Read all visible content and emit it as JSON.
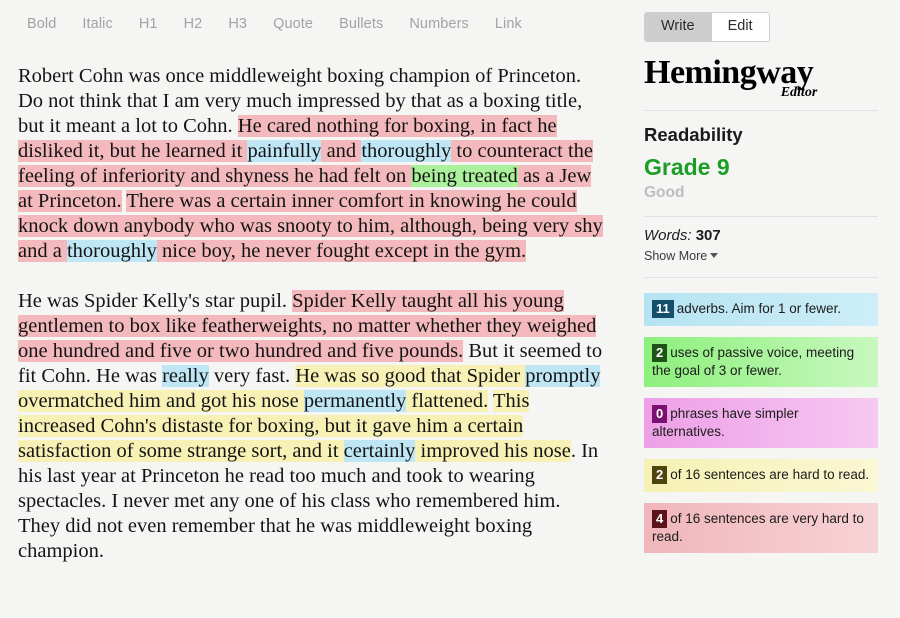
{
  "toolbar": {
    "items": [
      {
        "label": "Bold",
        "name": "bold"
      },
      {
        "label": "Italic",
        "name": "italic"
      },
      {
        "label": "H1",
        "name": "h1"
      },
      {
        "label": "H2",
        "name": "h2"
      },
      {
        "label": "H3",
        "name": "h3"
      },
      {
        "label": "Quote",
        "name": "quote"
      },
      {
        "label": "Bullets",
        "name": "bullets"
      },
      {
        "label": "Numbers",
        "name": "numbers"
      },
      {
        "label": "Link",
        "name": "link"
      }
    ]
  },
  "sidebar": {
    "mode": {
      "write_label": "Write",
      "edit_label": "Edit",
      "selected": "Write"
    },
    "brand": {
      "name": "Hemingway",
      "sub": "Editor"
    },
    "readability": {
      "title": "Readability",
      "grade": "Grade 9",
      "grade_color": "#1b9e26",
      "description": "Good",
      "words_label": "Words:",
      "words_value": "307",
      "show_more": "Show More"
    },
    "cards": [
      {
        "name": "adverbs",
        "count": "11",
        "text": "adverbs. Aim for 1 or fewer.",
        "color": "#b6e3f2",
        "badge_color": "#15506b"
      },
      {
        "name": "passive-voice",
        "count": "2",
        "text": "uses of passive voice, meeting the goal of 3 or fewer.",
        "color": "#8df07c",
        "badge_color": "#1d5416"
      },
      {
        "name": "qualifiers",
        "count": "0",
        "text": "phrases have simpler alternatives.",
        "color": "#ee9fe6",
        "badge_color": "#7a1070"
      },
      {
        "name": "hard-sentences",
        "count": "2",
        "text": "of 16 sentences are hard to read.",
        "color": "#f6f1b3",
        "badge_color": "#4f4310"
      },
      {
        "name": "very-hard-sentences",
        "count": "4",
        "text": "of 16 sentences are very hard to read.",
        "color": "#f0b6bb",
        "badge_color": "#5d1418"
      }
    ]
  },
  "document": {
    "paragraphs": [
      {
        "runs": [
          {
            "t": "Robert Cohn was once middleweight boxing champion of Princeton. Do not think that I am very much impressed by that as a boxing title, but it meant a lot to Cohn. ",
            "h": "none"
          },
          {
            "t": "He cared nothing for boxing, in fact he disliked it, but he learned it ",
            "h": "veryhard"
          },
          {
            "t": "painfully",
            "h": "adverb"
          },
          {
            "t": " and ",
            "h": "veryhard"
          },
          {
            "t": "thoroughly",
            "h": "adverb"
          },
          {
            "t": " to counteract the feeling of inferiority and shyness he had felt on ",
            "h": "veryhard"
          },
          {
            "t": "being treated",
            "h": "passive"
          },
          {
            "t": " as a Jew at Princeton.",
            "h": "veryhard"
          },
          {
            "t": " ",
            "h": "none"
          },
          {
            "t": "There was a certain inner comfort in knowing he could knock down anybody who was snooty to him, although, being very shy and a ",
            "h": "veryhard"
          },
          {
            "t": "thoroughly",
            "h": "adverb"
          },
          {
            "t": " nice boy, he never fought except in the gym.",
            "h": "veryhard"
          }
        ]
      },
      {
        "runs": [
          {
            "t": "He was Spider Kelly's star pupil. ",
            "h": "none"
          },
          {
            "t": "Spider Kelly taught all his young gentlemen to box like featherweights, no matter whether they weighed one hundred and five or two hundred and five pounds.",
            "h": "veryhard"
          },
          {
            "t": " But it seemed to fit Cohn. He was ",
            "h": "none"
          },
          {
            "t": "really",
            "h": "adverb"
          },
          {
            "t": " very fast. ",
            "h": "none"
          },
          {
            "t": "He was so good that Spider ",
            "h": "hard"
          },
          {
            "t": "promptly",
            "h": "adverb"
          },
          {
            "t": " overmatched him and got his nose ",
            "h": "hard"
          },
          {
            "t": "permanently",
            "h": "adverb"
          },
          {
            "t": " flattened.",
            "h": "hard"
          },
          {
            "t": " ",
            "h": "none"
          },
          {
            "t": "This increased Cohn's distaste for boxing, but it gave him a certain satisfaction of some strange sort, and it ",
            "h": "hard"
          },
          {
            "t": "certainly",
            "h": "adverb"
          },
          {
            "t": " improved his nose",
            "h": "hard"
          },
          {
            "t": ". In his last year at Princeton he read too much and took to wearing spectacles. I never met any one of his class who remembered him. They did not even remember that he was middleweight boxing champion.",
            "h": "none"
          }
        ]
      }
    ]
  }
}
